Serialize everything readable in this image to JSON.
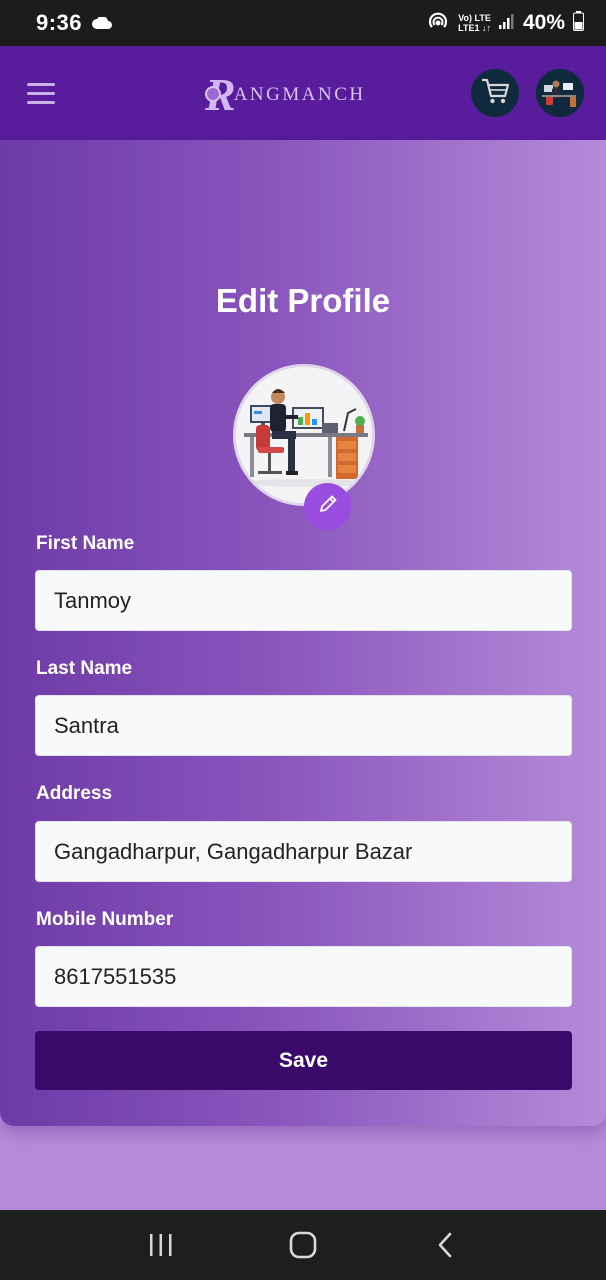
{
  "status_bar": {
    "time": "9:36",
    "network_top": "Vo) LTE",
    "network_bottom": "LTE1 ↓↑",
    "battery": "40%"
  },
  "header": {
    "logo_initial": "R",
    "logo_rest": "ANGMANCH",
    "menu_icon": "hamburger-icon",
    "cart_icon": "cart-icon"
  },
  "page": {
    "title": "Edit Profile"
  },
  "form": {
    "first_name_label": "First Name",
    "first_name_value": "Tanmoy",
    "last_name_label": "Last Name",
    "last_name_value": "Santra",
    "address_label": "Address",
    "address_value": "Gangadharpur, Gangadharpur Bazar",
    "mobile_label": "Mobile Number",
    "mobile_value": "8617551535",
    "save_label": "Save"
  },
  "colors": {
    "header": "#581c9c",
    "gradient_start": "#6e3aa6",
    "gradient_end": "#b58bd9",
    "save_button": "#3a0a6a",
    "edit_badge": "#9a4be0"
  }
}
